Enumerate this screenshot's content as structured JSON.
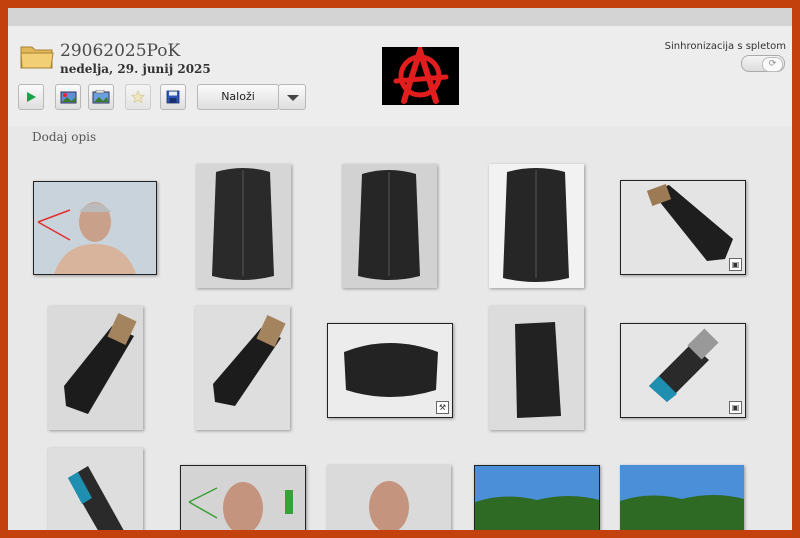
{
  "header": {
    "title": "29062025PoK",
    "subtitle": "nedelja, 29. junij 2025",
    "sync_label": "Sinhronizacija s spletom"
  },
  "toolbar": {
    "upload_label": "Naloži"
  },
  "content": {
    "description_placeholder": "Dodaj opis"
  },
  "colors": {
    "frame": "#c2410c",
    "play": "#16a34a",
    "anarchy": "#e11d1d"
  }
}
